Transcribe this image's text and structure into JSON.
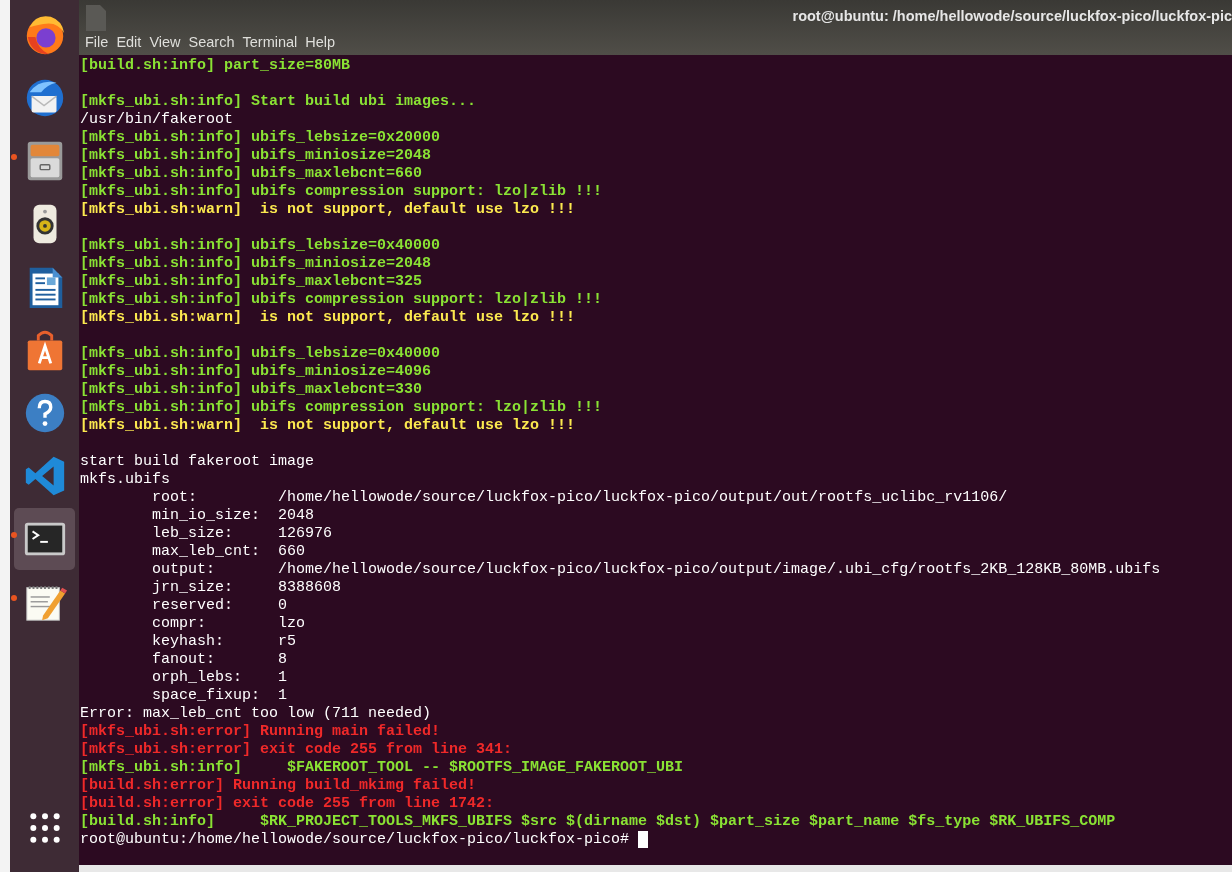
{
  "dock": {
    "items": [
      {
        "kind": "browser",
        "running": false,
        "selected": false
      },
      {
        "kind": "mail",
        "running": false,
        "selected": false
      },
      {
        "kind": "files",
        "running": true,
        "selected": false
      },
      {
        "kind": "music",
        "running": false,
        "selected": false
      },
      {
        "kind": "writer",
        "running": false,
        "selected": false
      },
      {
        "kind": "software",
        "running": false,
        "selected": false
      },
      {
        "kind": "help",
        "running": false,
        "selected": false
      },
      {
        "kind": "code",
        "running": false,
        "selected": false
      },
      {
        "kind": "terminal",
        "running": true,
        "selected": true
      },
      {
        "kind": "editor",
        "running": true,
        "selected": false
      }
    ],
    "apps_button": {
      "kind": "grid"
    }
  },
  "window": {
    "title": "root@ubuntu: /home/hellowode/source/luckfox-pico/luckfox-pic",
    "menu": [
      "File",
      "Edit",
      "View",
      "Search",
      "Terminal",
      "Help"
    ]
  },
  "terminal": {
    "lines": [
      {
        "kind": "info",
        "text": "[build.sh:info] part_size=80MB"
      },
      {
        "kind": "blank"
      },
      {
        "kind": "info",
        "text": "[mkfs_ubi.sh:info] Start build ubi images..."
      },
      {
        "kind": "plain",
        "text": "/usr/bin/fakeroot"
      },
      {
        "kind": "info",
        "text": "[mkfs_ubi.sh:info] ubifs_lebsize=0x20000"
      },
      {
        "kind": "info",
        "text": "[mkfs_ubi.sh:info] ubifs_miniosize=2048"
      },
      {
        "kind": "info",
        "text": "[mkfs_ubi.sh:info] ubifs_maxlebcnt=660"
      },
      {
        "kind": "info",
        "text": "[mkfs_ubi.sh:info] ubifs compression support: lzo|zlib !!!"
      },
      {
        "kind": "warn",
        "text": "[mkfs_ubi.sh:warn]  is not support, default use lzo !!!"
      },
      {
        "kind": "blank"
      },
      {
        "kind": "info",
        "text": "[mkfs_ubi.sh:info] ubifs_lebsize=0x40000"
      },
      {
        "kind": "info",
        "text": "[mkfs_ubi.sh:info] ubifs_miniosize=2048"
      },
      {
        "kind": "info",
        "text": "[mkfs_ubi.sh:info] ubifs_maxlebcnt=325"
      },
      {
        "kind": "info",
        "text": "[mkfs_ubi.sh:info] ubifs compression support: lzo|zlib !!!"
      },
      {
        "kind": "warn",
        "text": "[mkfs_ubi.sh:warn]  is not support, default use lzo !!!"
      },
      {
        "kind": "blank"
      },
      {
        "kind": "info",
        "text": "[mkfs_ubi.sh:info] ubifs_lebsize=0x40000"
      },
      {
        "kind": "info",
        "text": "[mkfs_ubi.sh:info] ubifs_miniosize=4096"
      },
      {
        "kind": "info",
        "text": "[mkfs_ubi.sh:info] ubifs_maxlebcnt=330"
      },
      {
        "kind": "info",
        "text": "[mkfs_ubi.sh:info] ubifs compression support: lzo|zlib !!!"
      },
      {
        "kind": "warn",
        "text": "[mkfs_ubi.sh:warn]  is not support, default use lzo !!!"
      },
      {
        "kind": "blank"
      },
      {
        "kind": "plain",
        "text": "start build fakeroot image"
      },
      {
        "kind": "plain",
        "text": "mkfs.ubifs"
      },
      {
        "kind": "plain",
        "text": "        root:         /home/hellowode/source/luckfox-pico/luckfox-pico/output/out/rootfs_uclibc_rv1106/"
      },
      {
        "kind": "plain",
        "text": "        min_io_size:  2048"
      },
      {
        "kind": "plain",
        "text": "        leb_size:     126976"
      },
      {
        "kind": "plain",
        "text": "        max_leb_cnt:  660"
      },
      {
        "kind": "plain",
        "text": "        output:       /home/hellowode/source/luckfox-pico/luckfox-pico/output/image/.ubi_cfg/rootfs_2KB_128KB_80MB.ubifs"
      },
      {
        "kind": "plain",
        "text": "        jrn_size:     8388608"
      },
      {
        "kind": "plain",
        "text": "        reserved:     0"
      },
      {
        "kind": "plain",
        "text": "        compr:        lzo"
      },
      {
        "kind": "plain",
        "text": "        keyhash:      r5"
      },
      {
        "kind": "plain",
        "text": "        fanout:       8"
      },
      {
        "kind": "plain",
        "text": "        orph_lebs:    1"
      },
      {
        "kind": "plain",
        "text": "        space_fixup:  1"
      },
      {
        "kind": "plain",
        "text": "Error: max_leb_cnt too low (711 needed)"
      },
      {
        "kind": "error",
        "text": "[mkfs_ubi.sh:error] Running main failed!"
      },
      {
        "kind": "error",
        "text": "[mkfs_ubi.sh:error] exit code 255 from line 341:"
      },
      {
        "kind": "info",
        "text": "[mkfs_ubi.sh:info]     $FAKEROOT_TOOL -- $ROOTFS_IMAGE_FAKEROOT_UBI"
      },
      {
        "kind": "error",
        "text": "[build.sh:error] Running build_mkimg failed!"
      },
      {
        "kind": "error",
        "text": "[build.sh:error] exit code 255 from line 1742:"
      },
      {
        "kind": "info",
        "text": "[build.sh:info]     $RK_PROJECT_TOOLS_MKFS_UBIFS $src $(dirname $dst) $part_size $part_name $fs_type $RK_UBIFS_COMP"
      },
      {
        "kind": "prompt",
        "text": "root@ubuntu:/home/hellowode/source/luckfox-pico/luckfox-pico# "
      }
    ]
  }
}
